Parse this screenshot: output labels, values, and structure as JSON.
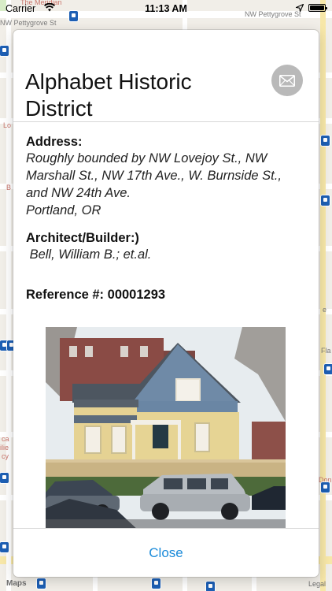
{
  "status_bar": {
    "carrier": "Carrier",
    "time": "11:13 AM"
  },
  "map": {
    "labels": {
      "street_top_left": "NW Pettygrove St",
      "street_top_right": "NW Pettygrove St",
      "place_top": "The Meridian",
      "left_edge_1": "Lo",
      "left_edge_2": "B",
      "left_edge_3": "ca",
      "left_edge_4": "ilie",
      "left_edge_5": "cy",
      "right_edge_1": "Fla",
      "right_edge_2": "Don",
      "right_edge_3": "e"
    },
    "legal_label": "Legal",
    "logo_label": "Maps",
    "accent_pin_color": "#1d5fb4"
  },
  "modal": {
    "title": "Alphabet Historic District",
    "share_icon": "envelope-icon",
    "address_label": "Address:",
    "address_value": "Roughly bounded by NW Lovejoy St., NW Marshall St., NW 17th Ave., W. Burnside St., and NW 24th Ave.",
    "city_value": "Portland, OR",
    "architect_label": "Architect/Builder:)",
    "architect_value": " Bell, William B.; et.al.",
    "reference_label": "Reference #:",
    "reference_value": "00001293",
    "photo_icon": "historic-house-photo",
    "close_label": "Close",
    "accent_color": "#1a8ad9"
  }
}
